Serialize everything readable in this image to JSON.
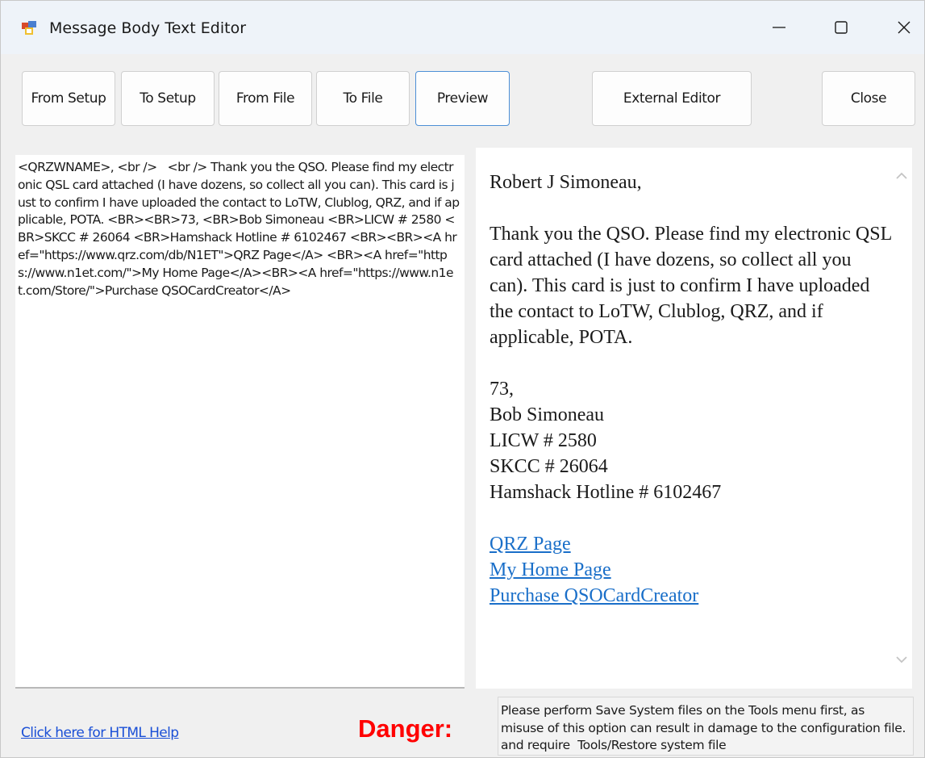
{
  "window": {
    "title": "Message Body Text Editor"
  },
  "toolbar": {
    "from_setup": "From Setup",
    "to_setup": "To Setup",
    "from_file": "From File",
    "to_file": "To File",
    "preview": "Preview",
    "external_editor": "External Editor",
    "close": "Close"
  },
  "source": {
    "text": "<QRZWNAME>, <br />   <br /> Thank you the QSO. Please find my electronic QSL card attached (I have dozens, so collect all you can). This card is just to confirm I have uploaded the contact to LoTW, Clublog, QRZ, and if applicable, POTA. <BR><BR>73, <BR>Bob Simoneau <BR>LICW # 2580 <BR>SKCC # 26064 <BR>Hamshack Hotline # 6102467 <BR><BR><A href=\"https://www.qrz.com/db/N1ET\">QRZ Page</A> <BR><A href=\"https://www.n1et.com/\">My Home Page</A><BR><A href=\"https://www.n1et.com/Store/\">Purchase QSOCardCreator</A>"
  },
  "preview": {
    "greeting": "Robert J Simoneau,",
    "body": "Thank you the QSO. Please find my electronic QSL card attached (I have dozens, so collect all you can). This card is just to confirm I have uploaded the contact to LoTW, Clublog, QRZ, and if applicable, POTA.",
    "sign_lines": [
      "73,",
      "Bob Simoneau",
      "LICW # 2580",
      "SKCC # 26064",
      "Hamshack Hotline # 6102467"
    ],
    "links": [
      "QRZ Page",
      "My Home Page",
      "Purchase QSOCardCreator"
    ]
  },
  "footer": {
    "help_link": "Click here for HTML Help",
    "danger_label": "Danger:",
    "warning": "Please perform Save System files on the Tools menu first, as misuse of this option can result in damage to the configuration file. and require  Tools/Restore system file"
  },
  "colors": {
    "danger": "#ff0000",
    "link": "#1a6fc9",
    "active_border": "#4d8fd6"
  }
}
